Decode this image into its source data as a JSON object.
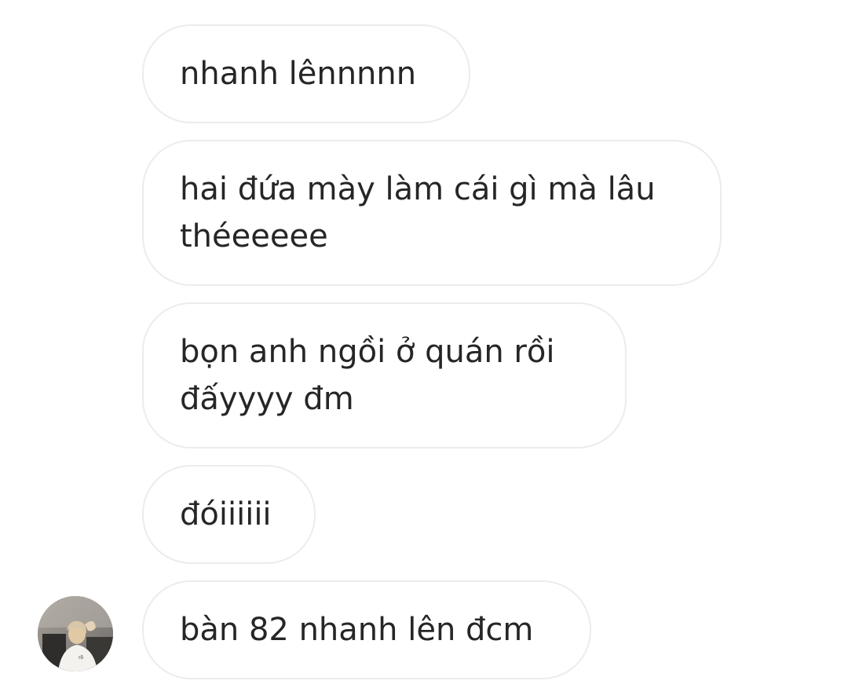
{
  "messages": [
    {
      "text": "nhanh lênnnnn"
    },
    {
      "text": "hai đứa mày làm cái gì mà lâu\nthéeeeee"
    },
    {
      "text": "bọn anh ngồi ở quán rồi\nđấyyyy đm"
    },
    {
      "text": "đóiiiiii"
    },
    {
      "text": "bàn 82 nhanh lên đcm"
    }
  ],
  "colors": {
    "bubble_border": "#ececec",
    "text": "#262626",
    "background": "#ffffff"
  }
}
